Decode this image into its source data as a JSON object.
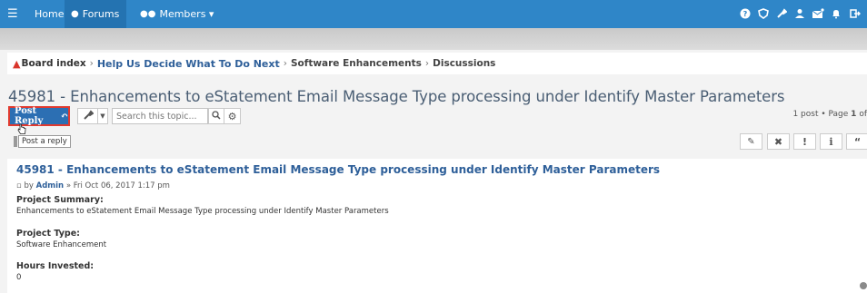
{
  "nav": {
    "home": "Home",
    "forums": "Forums",
    "members": "Members ▾"
  },
  "breadcrumbs": {
    "board_index": "Board index",
    "help": "Help Us Decide What To Do Next",
    "enhancements": "Software Enhancements",
    "discussions": "Discussions"
  },
  "topic": {
    "title": "45981 - Enhancements to eStatement Email Message Type processing under Identify Master Parameters",
    "post_reply": "Post Reply",
    "search_placeholder": "Search this topic...",
    "pagination_prefix": "1 post • Page",
    "page_num": "1",
    "pagination_suffix": "of",
    "tooltip": "Post a reply"
  },
  "post": {
    "title": "45981 - Enhancements to eStatement Email Message Type processing under Identify Master Parameters",
    "meta_prefix": "by",
    "author": "Admin",
    "meta_date": "» Fri Oct 06, 2017 1:17 pm",
    "fields": [
      {
        "label": "Project Summary:",
        "value": "Enhancements to eStatement Email Message Type processing under Identify Master Parameters"
      },
      {
        "label": "Project Type:",
        "value": "Software Enhancement"
      },
      {
        "label": "Hours Invested:",
        "value": "0"
      }
    ]
  },
  "icons": {
    "menu": "menu-icon",
    "forums": "chat-bubble-icon",
    "members": "users-icon",
    "help": "help-circle-icon",
    "shield": "shield-icon",
    "tools": "wrench-icon",
    "user": "user-icon",
    "messages": "envelope-icon",
    "notifications": "bell-icon",
    "logout": "logout-icon"
  },
  "colors": {
    "navbar": "#2f86c8",
    "link": "#2e5f99",
    "reply_button": "#2c6fb3",
    "highlight": "#e03a2f"
  }
}
